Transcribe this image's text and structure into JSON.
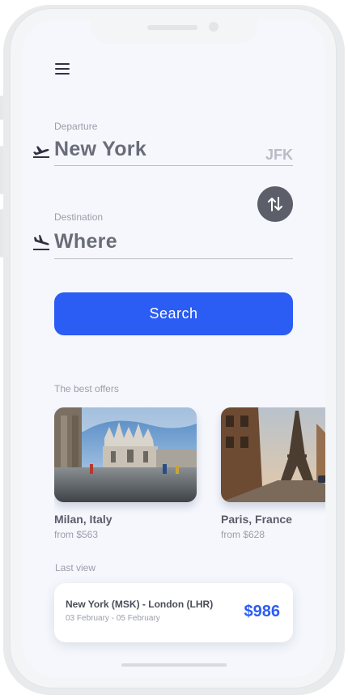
{
  "search": {
    "departure_label": "Departure",
    "departure_city": "New York",
    "departure_code": "JFK",
    "destination_label": "Destination",
    "destination_city": "Where",
    "search_button": "Search"
  },
  "offers": {
    "title": "The best offers",
    "items": [
      {
        "name": "Milan, Italy",
        "price": "from $563"
      },
      {
        "name": "Paris, France",
        "price": "from $628"
      }
    ]
  },
  "last_view": {
    "title": "Last view",
    "route": "New York (MSK) - London (LHR)",
    "dates": "03 February - 05 February",
    "price": "$986"
  },
  "colors": {
    "accent": "#2b5cf3",
    "swap_button": "#5c5e69",
    "screen_background": "#f5f7fd"
  },
  "icons": [
    "menu-icon",
    "plane-takeoff-icon",
    "plane-landing-icon",
    "swap-icon"
  ]
}
